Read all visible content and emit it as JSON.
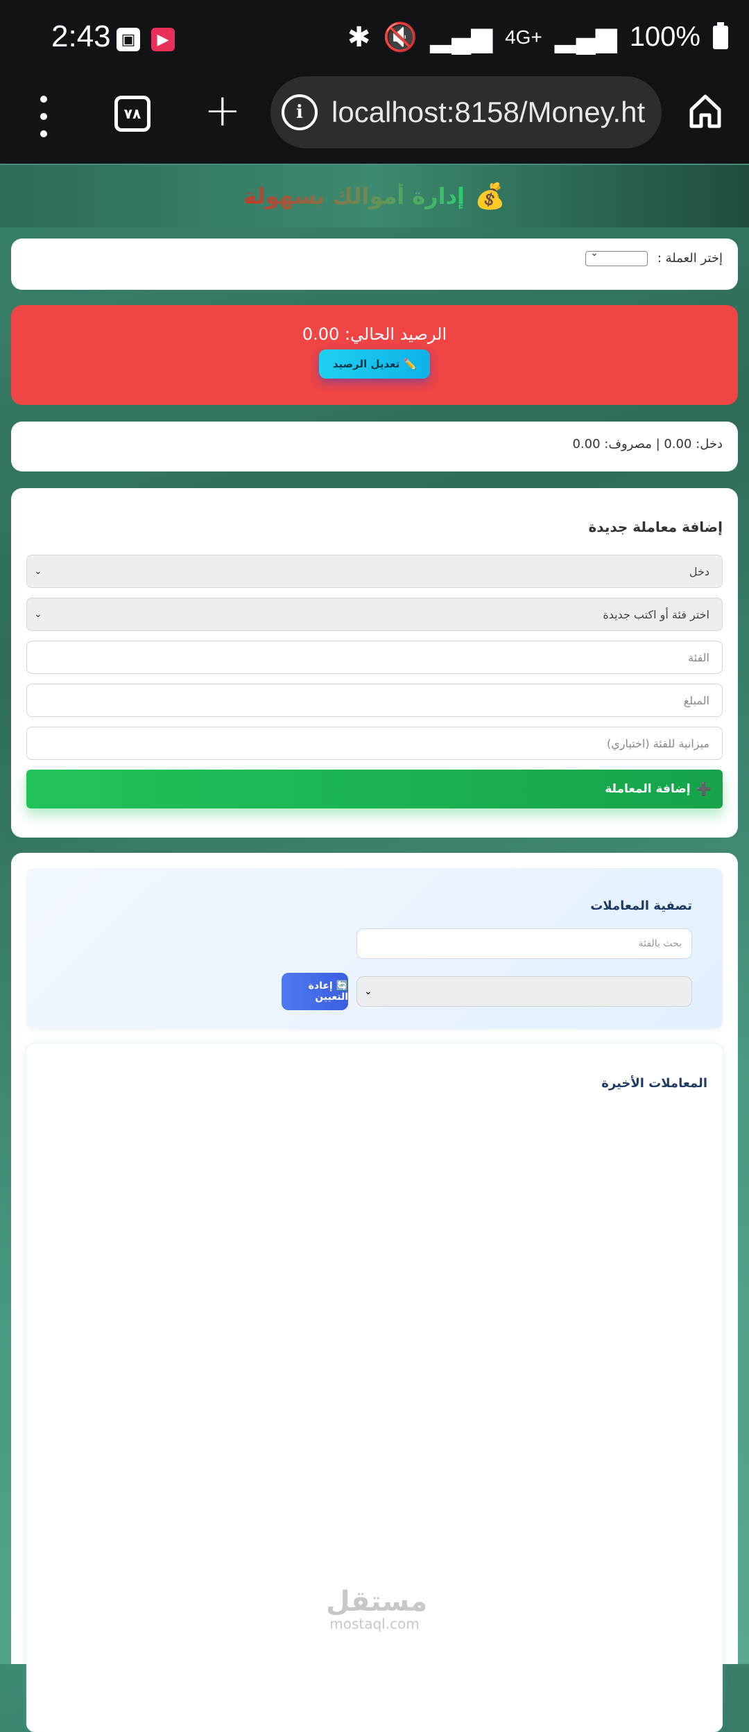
{
  "status_bar": {
    "time": "2:43",
    "icons": [
      "gallery-icon",
      "video-app-icon",
      "bluetooth-icon",
      "mute-icon",
      "signal-icon",
      "signal-icon"
    ],
    "network": "4G+",
    "battery": "100%"
  },
  "browser": {
    "tab_count": "٧٨",
    "url": "localhost:8158/Money.ht"
  },
  "header": {
    "title": "إدارة أموالك بسهولة",
    "icon": "💰"
  },
  "currency": {
    "label": "إختر العملة :",
    "selected": ""
  },
  "balance": {
    "text": "الرصيد الحالي: 0.00",
    "edit_button": "✏️ تعديل الرصيد",
    "color": "#ef4545"
  },
  "summary": {
    "text": "دخل: 0.00 | مصروف: 0.00"
  },
  "form": {
    "title": "إضافة معاملة جديدة",
    "type_select": "دخل",
    "category_select": "اختر فئة أو اكتب جديدة",
    "category_placeholder": "الفئة",
    "amount_placeholder": "المبلغ",
    "budget_placeholder": "ميزانية للفئة (اختياري)",
    "add_button": "إضافة المعاملة",
    "add_icon": "➕"
  },
  "filter": {
    "title": "تصفية المعاملات",
    "search_placeholder": "بحث بالفئة",
    "select_value": "",
    "reset_button": "🔄 إعادة التعيين"
  },
  "recent": {
    "title": "المعاملات الأخيرة"
  },
  "watermark": {
    "arabic": "مستقل",
    "latin": "mostaql.com"
  }
}
